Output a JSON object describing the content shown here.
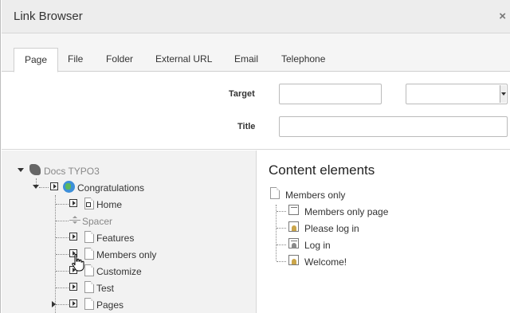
{
  "dialog": {
    "title": "Link Browser",
    "close_label": "×"
  },
  "tabs": [
    {
      "label": "Page",
      "active": true
    },
    {
      "label": "File"
    },
    {
      "label": "Folder"
    },
    {
      "label": "External URL"
    },
    {
      "label": "Email"
    },
    {
      "label": "Telephone"
    }
  ],
  "form": {
    "target_label": "Target",
    "target_value": "",
    "target_select_value": "",
    "title_label": "Title",
    "title_value": ""
  },
  "tree": {
    "root": "Docs TYPO3",
    "site": "Congratulations",
    "items": [
      "Home",
      "Spacer",
      "Features",
      "Members only",
      "Customize",
      "Test",
      "Pages"
    ]
  },
  "content": {
    "heading": "Content elements",
    "page": "Members only",
    "elements": [
      "Members only page",
      "Please log in",
      "Log in",
      "Welcome!"
    ]
  }
}
